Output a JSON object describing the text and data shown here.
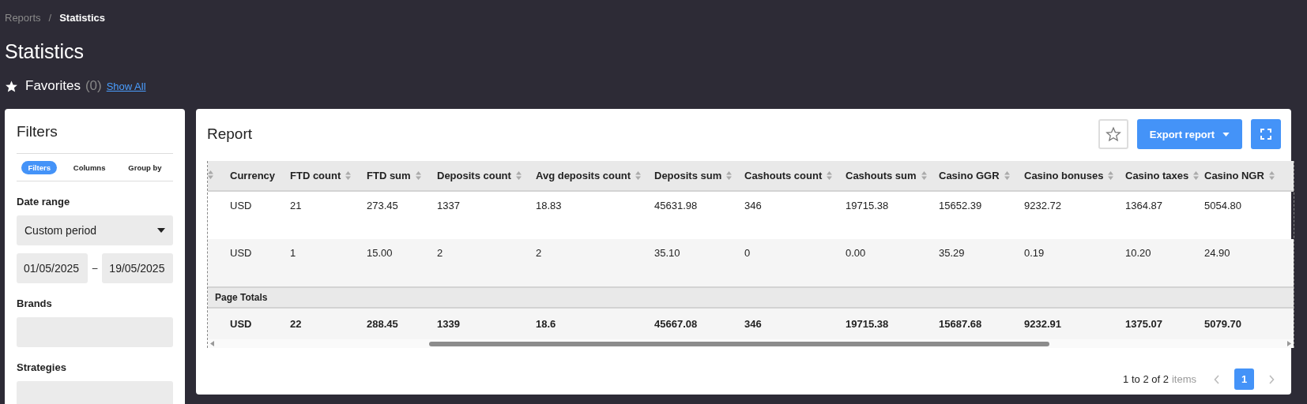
{
  "breadcrumb": [
    {
      "label": "Reports",
      "selected": false
    },
    {
      "label": "Statistics",
      "selected": true
    }
  ],
  "breadcrumb_separator": "/",
  "page_title": "Statistics",
  "favorites": {
    "label": "Favorites",
    "count": "(0)",
    "link": "Show All"
  },
  "filters": {
    "title": "Filters",
    "tabs": [
      {
        "label": "Filters",
        "selected": true
      },
      {
        "label": "Columns",
        "selected": false
      },
      {
        "label": "Group by",
        "selected": false
      }
    ],
    "date_range": {
      "label": "Date range",
      "value": "Custom period",
      "from": "01/05/2025",
      "separator": "–",
      "to": "19/05/2025"
    },
    "brands": {
      "label": "Brands"
    },
    "strategies": {
      "label": "Strategies"
    }
  },
  "report": {
    "title": "Report",
    "export_button": "Export report",
    "columns": [
      "Currency",
      "FTD count",
      "FTD sum",
      "Deposits count",
      "Avg deposits count",
      "Deposits sum",
      "Cashouts count",
      "Cashouts sum",
      "Casino GGR",
      "Casino bonuses",
      "Casino taxes",
      "Casino NGR"
    ],
    "rows": [
      [
        "USD",
        "21",
        "273.45",
        "1337",
        "18.83",
        "45631.98",
        "346",
        "19715.38",
        "15652.39",
        "9232.72",
        "1364.87",
        "5054.80"
      ],
      [
        "USD",
        "1",
        "15.00",
        "2",
        "2",
        "35.10",
        "0",
        "0.00",
        "35.29",
        "0.19",
        "10.20",
        "24.90"
      ]
    ],
    "totals_label": "Page Totals",
    "totals": [
      "USD",
      "22",
      "288.45",
      "1339",
      "18.6",
      "45667.08",
      "346",
      "19715.38",
      "15687.68",
      "9232.91",
      "1375.07",
      "5079.70"
    ],
    "pagination": {
      "range": "1 to 2 of 2",
      "unit": "items",
      "pages": [
        {
          "label": "1",
          "selected": true
        }
      ]
    }
  }
}
